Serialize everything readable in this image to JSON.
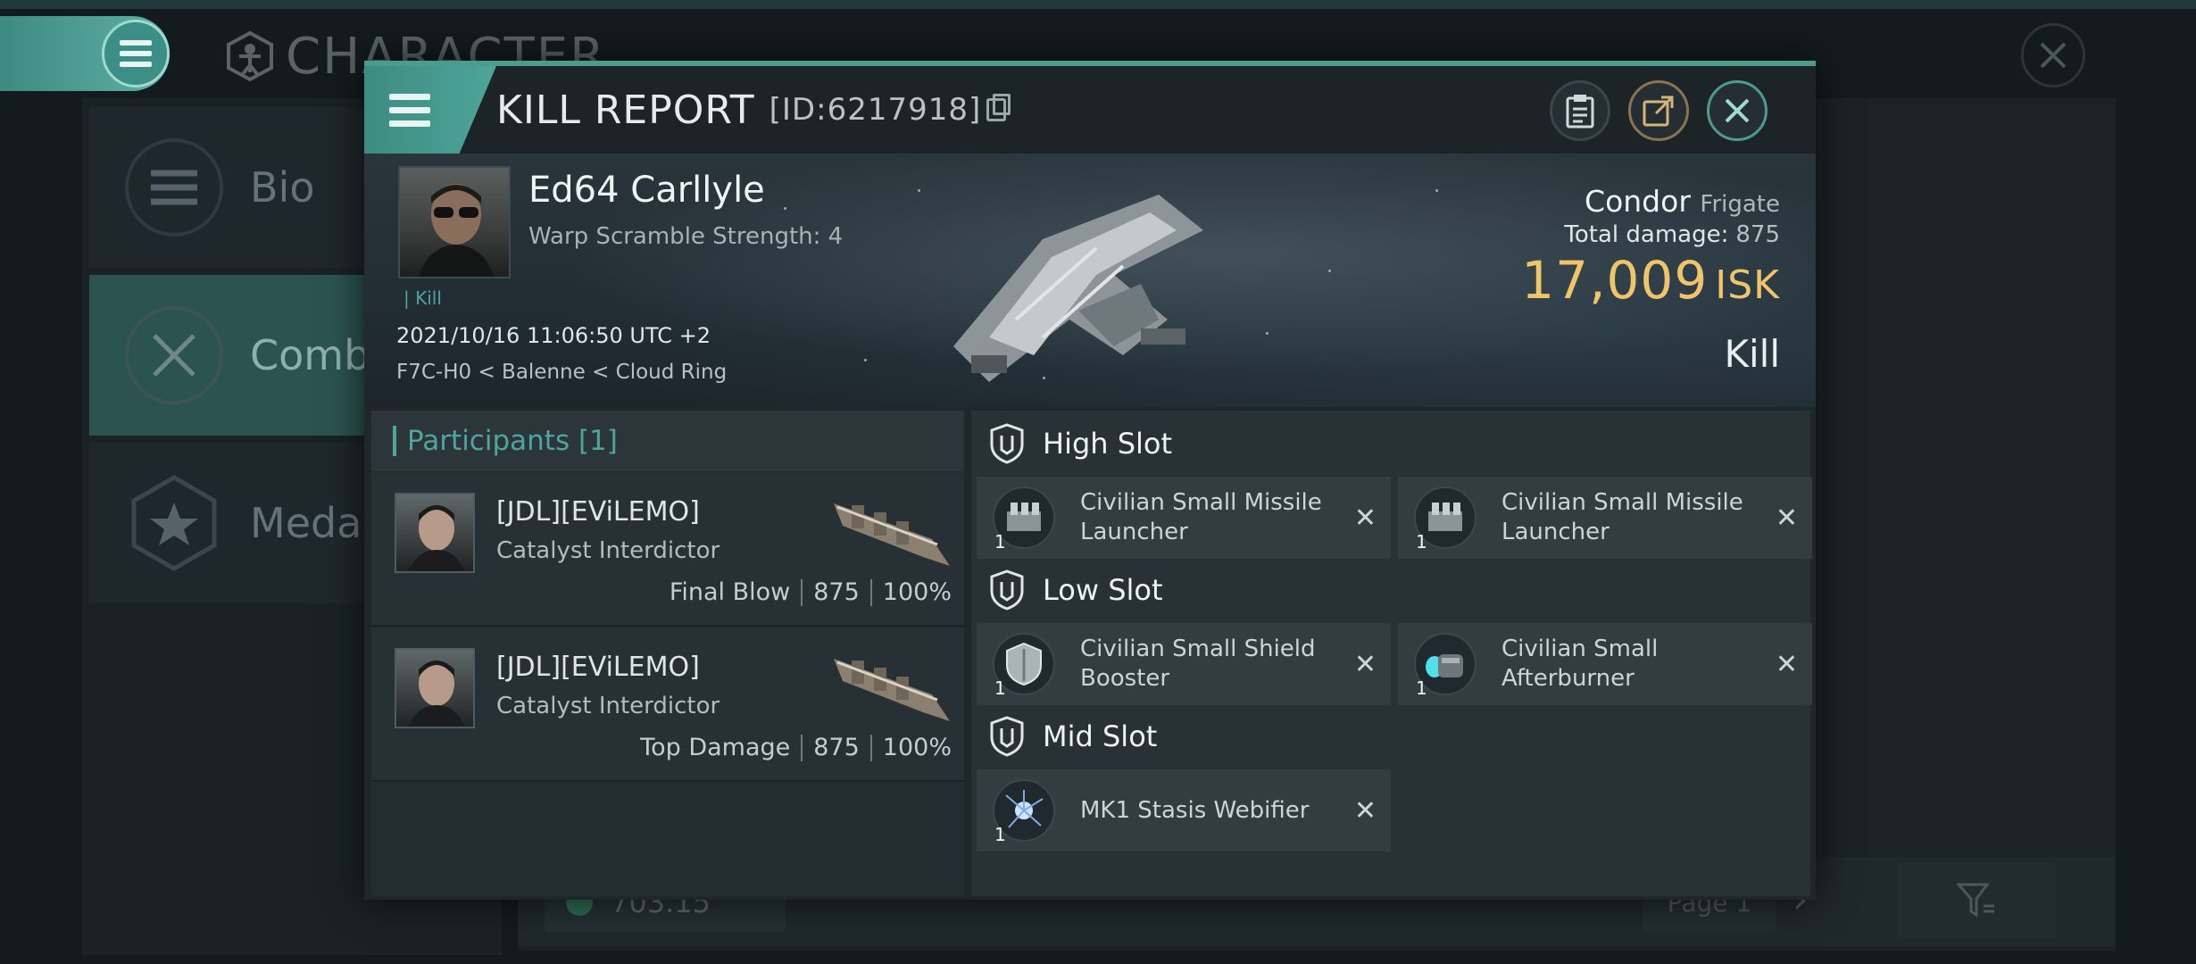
{
  "background": {
    "screen_title": "CHARACTER",
    "nav_items": [
      {
        "label": "Bio",
        "icon": "list-icon"
      },
      {
        "label": "Combat",
        "icon": "crossed-swords-icon"
      },
      {
        "label": "Medal",
        "icon": "star-icon"
      }
    ],
    "bottom_value": "703.15",
    "page_label": "Page 1"
  },
  "modal": {
    "title": "KILL REPORT",
    "id_label": "[ID:6217918]",
    "header_buttons": [
      "clipboard-icon",
      "share-icon",
      "close-icon"
    ]
  },
  "victim": {
    "name": "Ed64 Carllyle",
    "warp_scramble": "Warp Scramble Strength: 4",
    "tag": "Kill",
    "datetime": "2021/10/16 11:06:50 UTC +2",
    "location": "F7C-H0 < Balenne < Cloud Ring",
    "ship_name": "Condor",
    "ship_class": "Frigate",
    "total_damage_label": "Total damage:",
    "total_damage": "875",
    "isk_value": "17,009",
    "isk_unit": "ISK",
    "result": "Kill"
  },
  "participants": {
    "header": "Participants [1]",
    "rows": [
      {
        "name": "[JDL][EViLEMO]",
        "ship": "Catalyst Interdictor",
        "role": "Final Blow",
        "damage": "875",
        "percent": "100%"
      },
      {
        "name": "[JDL][EViLEMO]",
        "ship": "Catalyst Interdictor",
        "role": "Top Damage",
        "damage": "875",
        "percent": "100%"
      }
    ]
  },
  "slots": {
    "high": {
      "label": "High Slot",
      "modules": [
        {
          "name": "Civilian Small Missile Launcher",
          "qty": "1",
          "icon": "missile-launcher-icon"
        },
        {
          "name": "Civilian Small Missile Launcher",
          "qty": "1",
          "icon": "missile-launcher-icon"
        }
      ]
    },
    "low": {
      "label": "Low Slot",
      "modules": [
        {
          "name": "Civilian Small Shield Booster",
          "qty": "1",
          "icon": "shield-booster-icon"
        },
        {
          "name": "Civilian Small Afterburner",
          "qty": "1",
          "icon": "afterburner-icon"
        }
      ]
    },
    "mid": {
      "label": "Mid Slot",
      "modules": [
        {
          "name": "MK1 Stasis Webifier",
          "qty": "1",
          "icon": "stasis-webifier-icon"
        }
      ]
    }
  },
  "colors": {
    "accent": "#4ea59a",
    "isk": "#f0c56a"
  }
}
